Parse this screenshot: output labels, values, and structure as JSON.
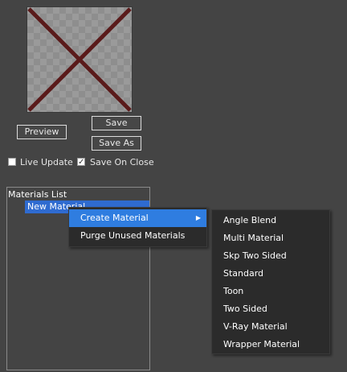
{
  "preview_area": {
    "swatch_icon": "no-texture-x-icon",
    "x_color": "#5a1a1a"
  },
  "buttons": {
    "preview": "Preview",
    "save": "Save",
    "save_as": "Save As"
  },
  "options": {
    "live_update": {
      "label": "Live Update",
      "checked": false
    },
    "save_on_close": {
      "label": "Save On Close",
      "checked": true
    }
  },
  "materials_list": {
    "title": "Materials List",
    "items": [
      "New Material"
    ]
  },
  "context_menu": {
    "items": [
      {
        "label": "Create Material",
        "has_submenu": true,
        "active": true
      },
      {
        "label": "Purge Unused Materials",
        "has_submenu": false,
        "active": false
      }
    ],
    "submenu": [
      "Angle Blend",
      "Multi Material",
      "Skp Two Sided",
      "Standard",
      "Toon",
      "Two Sided",
      "V-Ray Material",
      "Wrapper Material"
    ]
  },
  "colors": {
    "background": "#444444",
    "selection": "#2f6bd0",
    "menu_highlight": "#2f7de0",
    "menu_bg": "#2b2b2b"
  }
}
